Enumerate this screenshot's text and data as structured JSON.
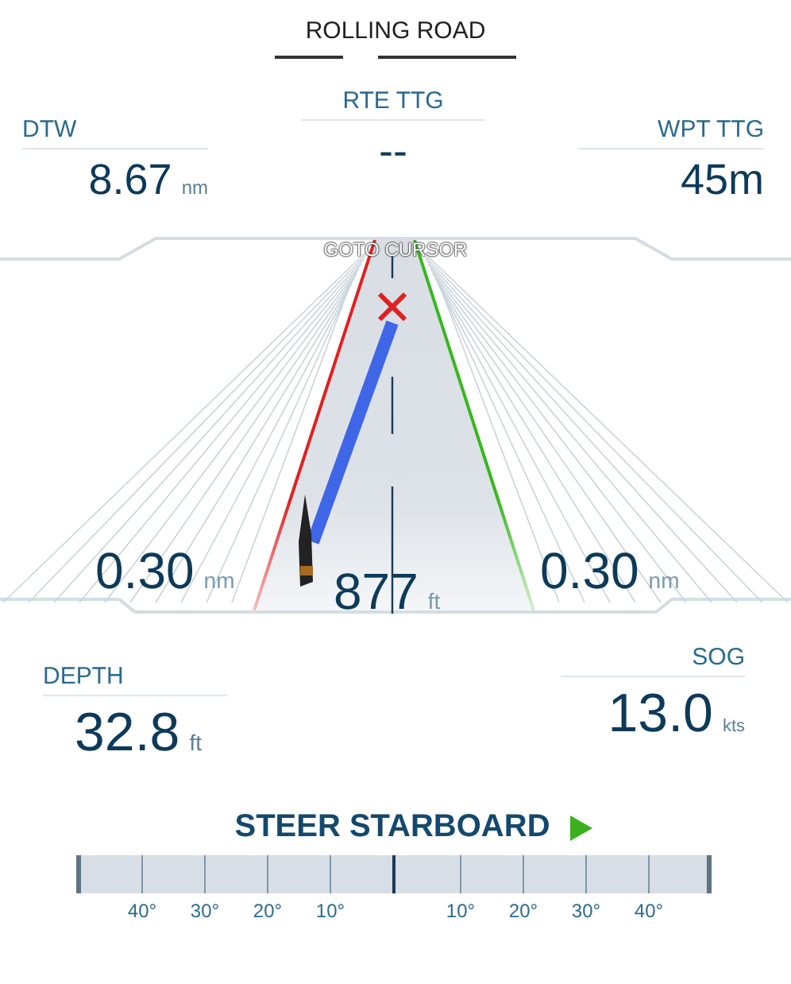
{
  "header": {
    "title": "ROLLING ROAD"
  },
  "top_fields": [
    {
      "label": "DTW",
      "value": "8.67",
      "unit": "nm",
      "kind": "left"
    },
    {
      "label": "RTE TTG",
      "value": "--",
      "kind": "center"
    },
    {
      "label": "WPT TTG",
      "value": "45m",
      "kind": "right"
    }
  ],
  "highway": {
    "mode": "GOTO CURSOR",
    "left_xte": {
      "value": "0.30",
      "unit": "nm"
    },
    "distance": {
      "value": "877",
      "unit": "ft"
    },
    "right_xte": {
      "value": "0.30",
      "unit": "nm"
    }
  },
  "bottom_fields": [
    {
      "label": "DEPTH",
      "value": "32.8",
      "unit": "ft",
      "kind": "left"
    },
    {
      "label": "SOG",
      "value": "13.0",
      "unit": "kts",
      "kind": "right"
    }
  ],
  "steer": {
    "text": "STEER STARBOARD",
    "kind": "starboard"
  },
  "scale": {
    "port_labels": [
      "40°",
      "30°",
      "20°",
      "10°"
    ],
    "starboard_labels": [
      "10°",
      "20°",
      "30°",
      "40°"
    ]
  }
}
